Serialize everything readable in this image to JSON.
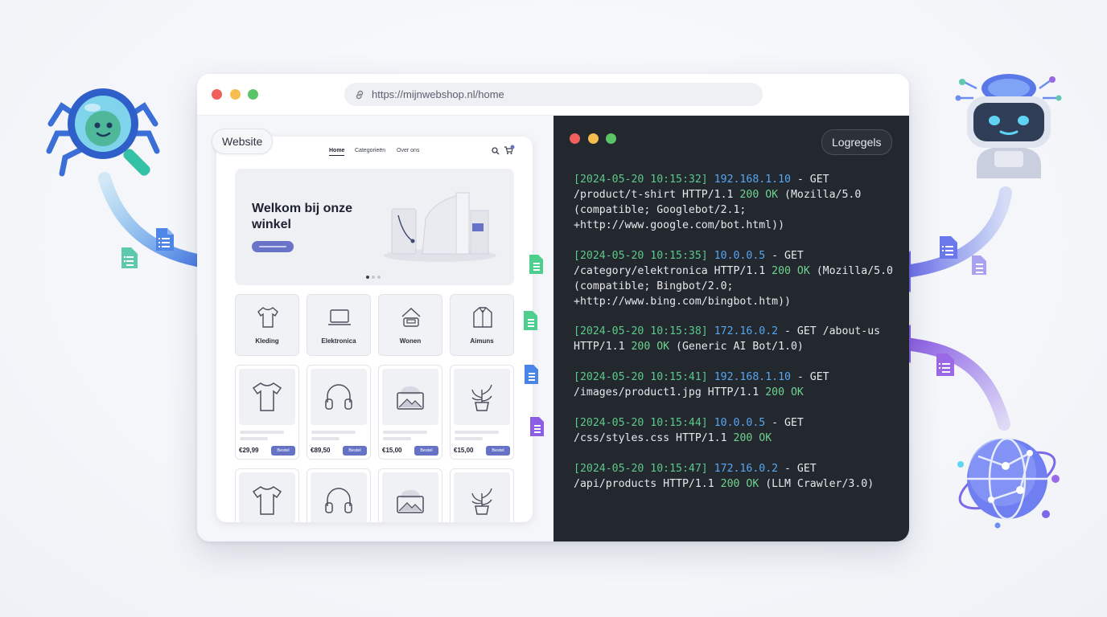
{
  "browser": {
    "url": "https://mijnwebshop.nl/home"
  },
  "website": {
    "label": "Website",
    "nav": [
      "Home",
      "Categorieën",
      "Over ons"
    ],
    "hero_title": "Welkom bij onze winkel",
    "categories": [
      "Kleding",
      "Elektronica",
      "Wonen",
      "Aimuns"
    ],
    "products_row1": [
      {
        "price": "€29,99",
        "button": "Bestel"
      },
      {
        "price": "€89,50",
        "button": "Bestel"
      },
      {
        "price": "€15,00",
        "button": "Bestel"
      },
      {
        "price": "€15,00",
        "button": "Bestel"
      }
    ]
  },
  "logs": {
    "label": "Logregels",
    "entries": [
      {
        "ts": "[2024-05-20 10:15:32]",
        "ip": "192.168.1.10",
        "pre": " - GET /product/t-shirt HTTP/1.1 ",
        "status": "200 OK",
        "ua": " (Mozilla/5.0 (compatible; Googlebot/2.1; +http://www.google.com/bot.html))"
      },
      {
        "ts": "[2024-05-20 10:15:35]",
        "ip": "10.0.0.5",
        "pre": " - GET /category/elektronica HTTP/1.1 ",
        "status": "200 OK",
        "ua": " (Mozilla/5.0 (compatible; Bingbot/2.0; +http://www.bing.com/bingbot.htm))"
      },
      {
        "ts": "[2024-05-20 10:15:38]",
        "ip": "172.16.0.2",
        "pre": " - GET /about-us HTTP/1.1 ",
        "status": "200 OK",
        "ua": " (Generic AI Bot/1.0)"
      },
      {
        "ts": "[2024-05-20 10:15:41]",
        "ip": "192.168.1.10",
        "pre": " - GET /images/product1.jpg HTTP/1.1 ",
        "status": "200 OK",
        "ua": ""
      },
      {
        "ts": "[2024-05-20 10:15:44]",
        "ip": "10.0.0.5",
        "pre": " - GET /css/styles.css HTTP/1.1 ",
        "status": "200 OK",
        "ua": ""
      },
      {
        "ts": "[2024-05-20 10:15:47]",
        "ip": "172.16.0.2",
        "pre": " - GET /api/products HTTP/1.1 ",
        "status": "200 OK",
        "ua": " (LLM Crawler/3.0)"
      }
    ]
  },
  "colors": {
    "timestamp": "#5dc98a",
    "ip": "#56a6f0",
    "status_ok": "#6fd28f",
    "log_bg": "#23282f",
    "accent": "#6572c6"
  },
  "icons": [
    "spider-magnifier-icon",
    "ai-robot-icon",
    "globe-network-icon",
    "document-icon",
    "link-icon",
    "search-icon",
    "cart-icon"
  ]
}
